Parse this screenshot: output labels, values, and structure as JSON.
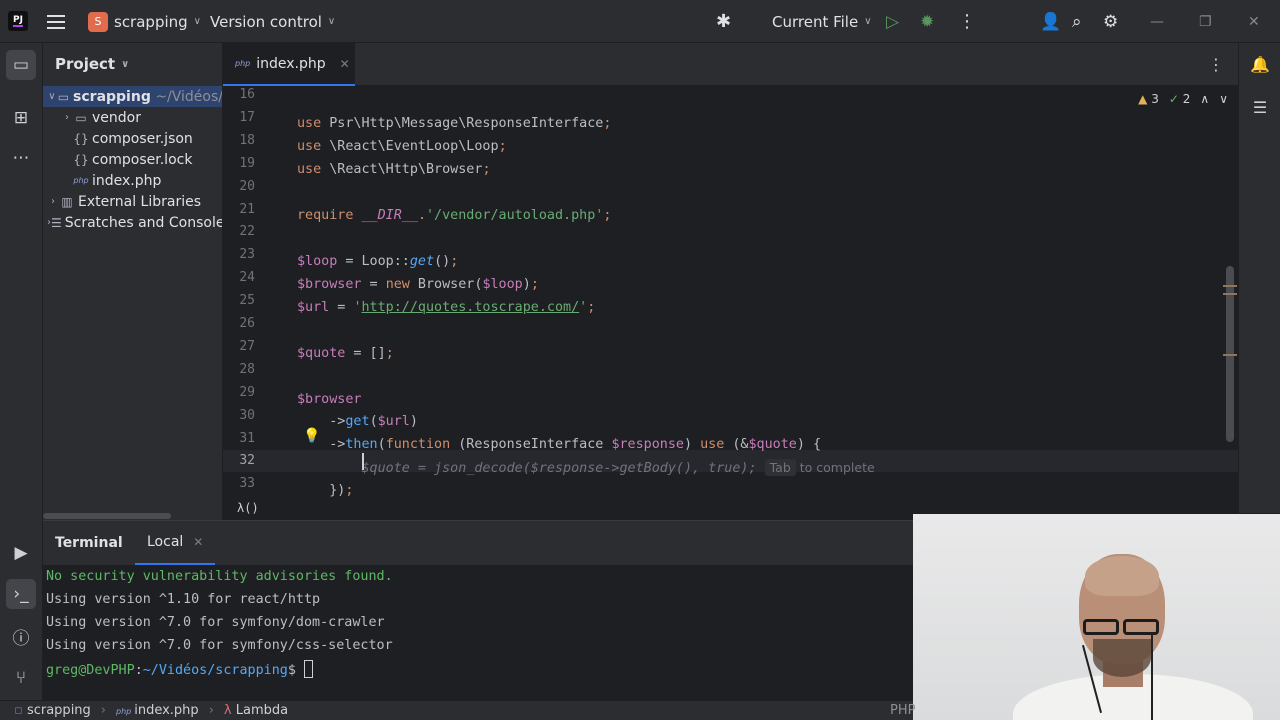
{
  "titlebar": {
    "logo": "PJ",
    "project_initial": "S",
    "project_name": "scrapping",
    "version_control": "Version control",
    "run_config": "Current File",
    "icons": [
      "menu-icon",
      "bug-icon",
      "run-icon",
      "debug-icon",
      "more-icon",
      "add-user-icon",
      "search-icon",
      "settings-icon",
      "minimize-icon",
      "maximize-icon",
      "close-icon"
    ]
  },
  "project_panel": {
    "title": "Project",
    "root": {
      "name": "scrapping",
      "path": "~/Vidéos/"
    },
    "items": [
      {
        "label": "vendor",
        "icon": "folder-icon"
      },
      {
        "label": "composer.json",
        "icon": "json-icon"
      },
      {
        "label": "composer.lock",
        "icon": "json-icon"
      },
      {
        "label": "index.php",
        "icon": "php-icon"
      },
      {
        "label": "External Libraries",
        "icon": "library-icon"
      },
      {
        "label": "Scratches and Consoles",
        "icon": "scratches-icon"
      }
    ]
  },
  "editor": {
    "tab": {
      "label": "index.php",
      "icon_text": "php"
    },
    "inspections": {
      "warnings": "3",
      "ok": "2"
    },
    "line_numbers": [
      "16",
      "17",
      "18",
      "19",
      "20",
      "21",
      "22",
      "23",
      "24",
      "25",
      "26",
      "27",
      "28",
      "29",
      "30",
      "31",
      "32",
      "33"
    ],
    "current_line": "32",
    "completion": {
      "ghost": "$quote = json_decode($response->getBody(), true);",
      "key": "Tab",
      "hint": "to complete"
    },
    "breadcrumb": "λ()"
  },
  "terminal": {
    "title": "Terminal",
    "tab": "Local",
    "lines": [
      "No security vulnerability advisories found.",
      "Using version ^1.10 for react/http",
      "Using version ^7.0 for symfony/dom-crawler",
      "Using version ^7.0 for symfony/css-selector"
    ],
    "prompt_user": "greg@DevPHP",
    "prompt_path": "~/Vidéos/scrapping",
    "prompt_symbol": "$"
  },
  "statusbar": {
    "items": [
      "scrapping",
      "index.php",
      "Lambda"
    ],
    "right": "PHP"
  },
  "colors": {
    "accent": "#3574f0",
    "keyword": "#cf8e6d",
    "variable": "#c77dbb",
    "function": "#56a8f5",
    "string": "#6aab73",
    "terminal_green": "#5fb865"
  }
}
